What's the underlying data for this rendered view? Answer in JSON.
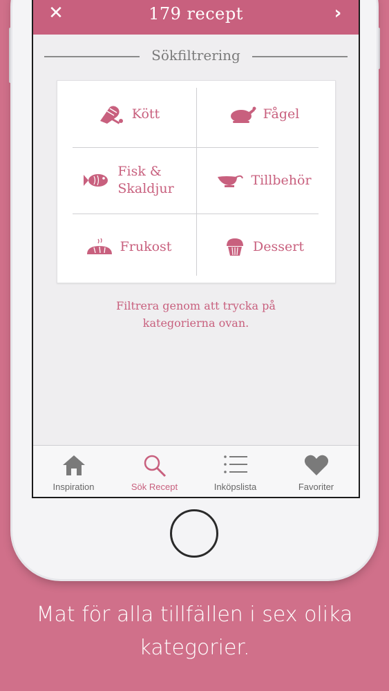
{
  "header": {
    "close_label": "✕",
    "title": "179 recept",
    "next_label": "›"
  },
  "filter": {
    "section_title": "Sökfiltrering",
    "categories": [
      {
        "label": "Kött",
        "icon": "ham-icon"
      },
      {
        "label": "Fågel",
        "icon": "chicken-icon"
      },
      {
        "label": "Fisk &\nSkaldjur",
        "icon": "fish-icon"
      },
      {
        "label": "Tillbehör",
        "icon": "gravy-boat-icon"
      },
      {
        "label": "Frukost",
        "icon": "bread-icon"
      },
      {
        "label": "Dessert",
        "icon": "cupcake-icon"
      }
    ],
    "hint_line1": "Filtrera genom att trycka på",
    "hint_line2": "kategorierna ovan."
  },
  "tabbar": {
    "tabs": [
      {
        "label": "Inspiration",
        "icon": "home-icon",
        "active": false
      },
      {
        "label": "Sök Recept",
        "icon": "search-icon",
        "active": true
      },
      {
        "label": "Inköpslista",
        "icon": "list-icon",
        "active": false
      },
      {
        "label": "Favoriter",
        "icon": "heart-icon",
        "active": false
      }
    ]
  },
  "caption": {
    "line1": "Mat för alla tillfällen i sex olika",
    "line2": "kategorier."
  },
  "colors": {
    "accent": "#c8607e",
    "background": "#d0708a",
    "tab_inactive": "#666666"
  }
}
